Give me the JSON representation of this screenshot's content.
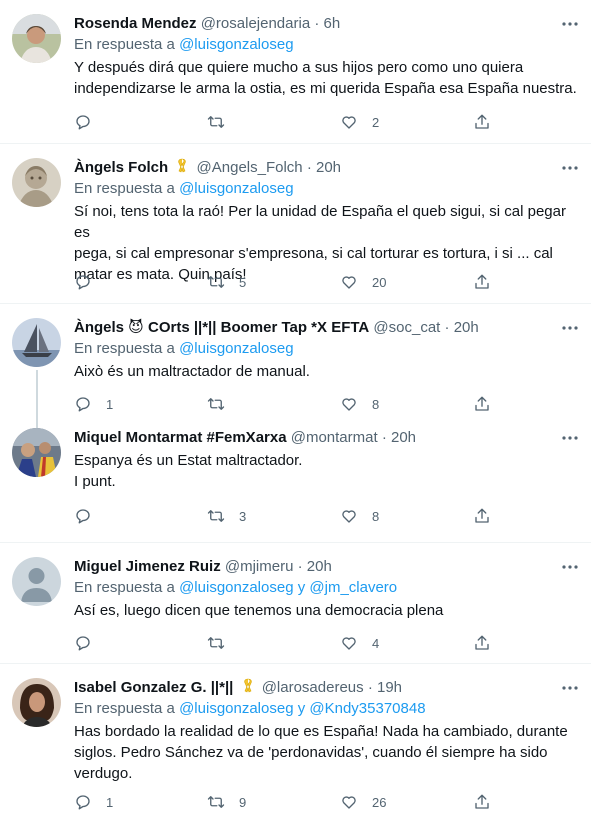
{
  "tweets": [
    {
      "name": "Rosenda Mendez",
      "handle": "@rosalejendaria",
      "dot": "·",
      "time": "6h",
      "reply_prefix": "En respuesta a",
      "mentions": [
        "@luisgonzaloseg"
      ],
      "text_lines": [
        "Y después dirá que quiere  mucho a sus hijos pero como uno quiera",
        "independizarse le arma la ostia, es mi querida España esa España nuestra."
      ],
      "replies": "",
      "retweets": "",
      "likes": "2"
    },
    {
      "name": "Àngels Folch",
      "badge_icon": "yellow-ribbon-icon",
      "handle": "@Angels_Folch",
      "dot": "·",
      "time": "20h",
      "reply_prefix": "En respuesta a",
      "mentions": [
        "@luisgonzaloseg"
      ],
      "text_lines": [
        "Sí noi, tens tota la raó! Per la unidad de España el queb sigui, si cal pegar es",
        "pega, si cal empresonar s'empresona, si cal torturar es tortura, i si ... cal",
        "matar es mata. Quin país!"
      ],
      "replies": "",
      "retweets": "5",
      "likes": "20"
    },
    {
      "name": "Àngels 😈 COrts ||*|| Boomer Tap *X EFTA",
      "handle": "@soc_cat",
      "dot": "·",
      "time": "20h",
      "reply_prefix": "En respuesta a",
      "mentions": [
        "@luisgonzaloseg"
      ],
      "text_lines": [
        "Això és un maltractador de manual."
      ],
      "replies": "1",
      "retweets": "",
      "likes": "8"
    },
    {
      "name": "Miquel Montarmat #FemXarxa",
      "handle": "@montarmat",
      "dot": "·",
      "time": "20h",
      "reply_prefix": "",
      "mentions": [],
      "text_lines": [
        "Espanya és un Estat maltractador.",
        "I punt."
      ],
      "replies": "",
      "retweets": "3",
      "likes": "8"
    },
    {
      "name": "Miguel Jimenez Ruiz",
      "handle": "@mjimeru",
      "dot": "·",
      "time": "20h",
      "reply_prefix": "En respuesta a",
      "mentions": [
        "@luisgonzaloseg",
        "@jm_clavero"
      ],
      "conjunction": "y",
      "text_lines": [
        "Así es, luego dicen que tenemos una democracia plena"
      ],
      "replies": "",
      "retweets": "",
      "likes": "4"
    },
    {
      "name": "Isabel Gonzalez G. ||*||",
      "badge_icon": "yellow-ribbon-icon",
      "handle": "@larosadereus",
      "dot": "·",
      "time": "19h",
      "reply_prefix": "En respuesta a",
      "mentions": [
        "@luisgonzaloseg",
        "@Kndy35370848"
      ],
      "conjunction": "y",
      "text_lines": [
        "Has bordado la realidad de lo que es España! Nada ha cambiado, durante",
        "siglos. Pedro Sánchez va de 'perdonavidas', cuando él siempre ha sido",
        "verdugo."
      ],
      "replies": "1",
      "retweets": "9",
      "likes": "26"
    }
  ],
  "icons": {
    "reply": "reply-icon",
    "retweet": "retweet-icon",
    "like": "heart-icon",
    "share": "share-icon",
    "more": "more-dots-icon"
  },
  "colors": {
    "link": "#1d9bf0",
    "secondary": "#536471",
    "ribbon": "#f4c430"
  }
}
